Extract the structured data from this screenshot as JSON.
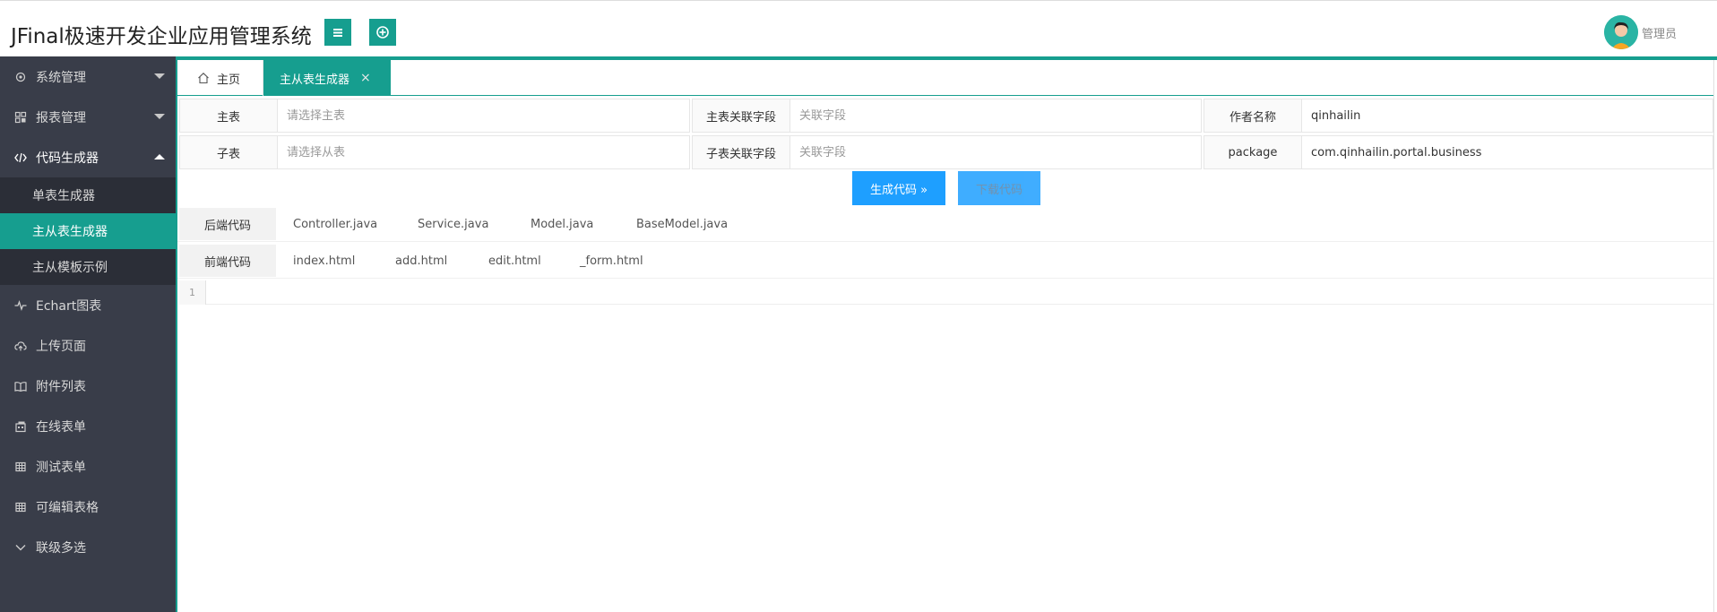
{
  "header": {
    "title": "JFinal极速开发企业应用管理系统",
    "user_name": "管理员"
  },
  "sidebar": {
    "items": [
      {
        "label": "系统管理",
        "icon": "gear-icon"
      },
      {
        "label": "报表管理",
        "icon": "report-icon"
      },
      {
        "label": "代码生成器",
        "icon": "code-icon"
      },
      {
        "label": "Echart图表",
        "icon": "pulse-icon"
      },
      {
        "label": "上传页面",
        "icon": "cloud-upload-icon"
      },
      {
        "label": "附件列表",
        "icon": "book-icon"
      },
      {
        "label": "在线表单",
        "icon": "form-icon"
      },
      {
        "label": "测试表单",
        "icon": "table-icon"
      },
      {
        "label": "可编辑表格",
        "icon": "table-icon"
      },
      {
        "label": "联级多选",
        "icon": "chevron-down-icon"
      }
    ],
    "subitems": [
      {
        "label": "单表生成器"
      },
      {
        "label": "主从表生成器"
      },
      {
        "label": "主从模板示例"
      }
    ]
  },
  "tabs": {
    "home": "主页",
    "active": "主从表生成器",
    "close": "×"
  },
  "form": {
    "main_table_label": "主表",
    "main_table_placeholder": "请选择主表",
    "main_key_label": "主表关联字段",
    "main_key_placeholder": "关联字段",
    "author_label": "作者名称",
    "author_value": "qinhailin",
    "sub_table_label": "子表",
    "sub_table_placeholder": "请选择从表",
    "sub_key_label": "子表关联字段",
    "sub_key_placeholder": "关联字段",
    "package_label": "package",
    "package_value": "com.qinhailin.portal.business"
  },
  "buttons": {
    "generate": "生成代码 »",
    "download": "下载代码"
  },
  "code": {
    "backend_label": "后端代码",
    "backend_files": [
      "Controller.java",
      "Service.java",
      "Model.java",
      "BaseModel.java"
    ],
    "frontend_label": "前端代码",
    "frontend_files": [
      "index.html",
      "add.html",
      "edit.html",
      "_form.html"
    ],
    "line_number": "1"
  },
  "colors": {
    "accent": "#169e8f",
    "sidebar_bg": "#393d49",
    "button_blue": "#1e9fff"
  }
}
